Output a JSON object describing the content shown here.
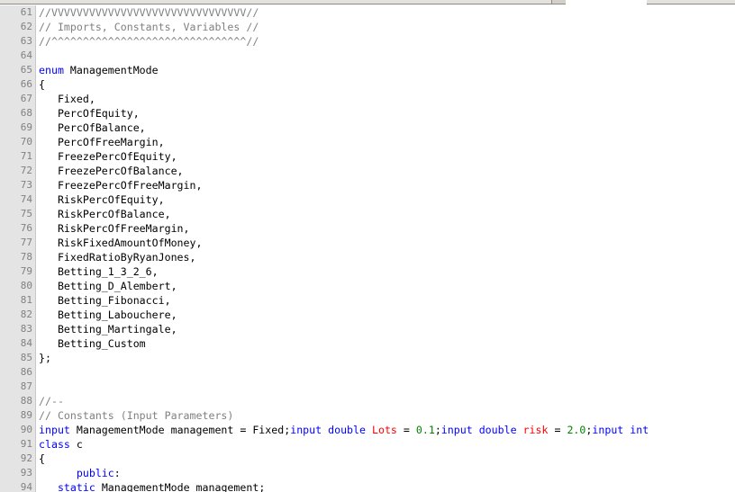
{
  "editor": {
    "lines": [
      {
        "no": "61",
        "tokens": [
          {
            "t": "//VVVVVVVVVVVVVVVVVVVVVVVVVVVVVVV//",
            "c": "comment"
          }
        ]
      },
      {
        "no": "62",
        "tokens": [
          {
            "t": "// Imports, Constants, Variables //",
            "c": "comment"
          }
        ]
      },
      {
        "no": "63",
        "tokens": [
          {
            "t": "//^^^^^^^^^^^^^^^^^^^^^^^^^^^^^^^//",
            "c": "comment"
          }
        ]
      },
      {
        "no": "64",
        "tokens": []
      },
      {
        "no": "65",
        "tokens": [
          {
            "t": "enum",
            "c": "keyword"
          },
          {
            "t": " ManagementMode",
            "c": "plain"
          }
        ]
      },
      {
        "no": "66",
        "tokens": [
          {
            "t": "{",
            "c": "plain"
          }
        ]
      },
      {
        "no": "67",
        "tokens": [
          {
            "t": "   Fixed,",
            "c": "plain"
          }
        ]
      },
      {
        "no": "68",
        "tokens": [
          {
            "t": "   PercOfEquity,",
            "c": "plain"
          }
        ]
      },
      {
        "no": "69",
        "tokens": [
          {
            "t": "   PercOfBalance,",
            "c": "plain"
          }
        ]
      },
      {
        "no": "70",
        "tokens": [
          {
            "t": "   PercOfFreeMargin,",
            "c": "plain"
          }
        ]
      },
      {
        "no": "71",
        "tokens": [
          {
            "t": "   FreezePercOfEquity,",
            "c": "plain"
          }
        ]
      },
      {
        "no": "72",
        "tokens": [
          {
            "t": "   FreezePercOfBalance,",
            "c": "plain"
          }
        ]
      },
      {
        "no": "73",
        "tokens": [
          {
            "t": "   FreezePercOfFreeMargin,",
            "c": "plain"
          }
        ]
      },
      {
        "no": "74",
        "tokens": [
          {
            "t": "   RiskPercOfEquity,",
            "c": "plain"
          }
        ]
      },
      {
        "no": "75",
        "tokens": [
          {
            "t": "   RiskPercOfBalance,",
            "c": "plain"
          }
        ]
      },
      {
        "no": "76",
        "tokens": [
          {
            "t": "   RiskPercOfFreeMargin,",
            "c": "plain"
          }
        ]
      },
      {
        "no": "77",
        "tokens": [
          {
            "t": "   RiskFixedAmountOfMoney,",
            "c": "plain"
          }
        ]
      },
      {
        "no": "78",
        "tokens": [
          {
            "t": "   FixedRatioByRyanJones,",
            "c": "plain"
          }
        ]
      },
      {
        "no": "79",
        "tokens": [
          {
            "t": "   Betting_1_3_2_6,",
            "c": "plain"
          }
        ]
      },
      {
        "no": "80",
        "tokens": [
          {
            "t": "   Betting_D_Alembert,",
            "c": "plain"
          }
        ]
      },
      {
        "no": "81",
        "tokens": [
          {
            "t": "   Betting_Fibonacci,",
            "c": "plain"
          }
        ]
      },
      {
        "no": "82",
        "tokens": [
          {
            "t": "   Betting_Labouchere,",
            "c": "plain"
          }
        ]
      },
      {
        "no": "83",
        "tokens": [
          {
            "t": "   Betting_Martingale,",
            "c": "plain"
          }
        ]
      },
      {
        "no": "84",
        "tokens": [
          {
            "t": "   Betting_Custom",
            "c": "plain"
          }
        ]
      },
      {
        "no": "85",
        "tokens": [
          {
            "t": "};",
            "c": "plain"
          }
        ]
      },
      {
        "no": "86",
        "tokens": []
      },
      {
        "no": "87",
        "tokens": []
      },
      {
        "no": "88",
        "tokens": [
          {
            "t": "//--",
            "c": "comment"
          }
        ]
      },
      {
        "no": "89",
        "tokens": [
          {
            "t": "// Constants (Input Parameters)",
            "c": "comment"
          }
        ]
      },
      {
        "no": "90",
        "tokens": [
          {
            "t": "input",
            "c": "keyword"
          },
          {
            "t": " ManagementMode management = Fixed;",
            "c": "plain"
          },
          {
            "t": "input",
            "c": "keyword"
          },
          {
            "t": " ",
            "c": "plain"
          },
          {
            "t": "double",
            "c": "type"
          },
          {
            "t": " ",
            "c": "plain"
          },
          {
            "t": "Lots",
            "c": "var"
          },
          {
            "t": " = ",
            "c": "plain"
          },
          {
            "t": "0.1",
            "c": "number"
          },
          {
            "t": ";",
            "c": "plain"
          },
          {
            "t": "input",
            "c": "keyword"
          },
          {
            "t": " ",
            "c": "plain"
          },
          {
            "t": "double",
            "c": "type"
          },
          {
            "t": " ",
            "c": "plain"
          },
          {
            "t": "risk",
            "c": "var"
          },
          {
            "t": " = ",
            "c": "plain"
          },
          {
            "t": "2.0",
            "c": "number"
          },
          {
            "t": ";",
            "c": "plain"
          },
          {
            "t": "input",
            "c": "keyword"
          },
          {
            "t": " ",
            "c": "plain"
          },
          {
            "t": "int",
            "c": "type"
          }
        ]
      },
      {
        "no": "91",
        "tokens": [
          {
            "t": "class",
            "c": "keyword"
          },
          {
            "t": " c",
            "c": "plain"
          }
        ]
      },
      {
        "no": "92",
        "tokens": [
          {
            "t": "{",
            "c": "plain"
          }
        ]
      },
      {
        "no": "93",
        "tokens": [
          {
            "t": "      ",
            "c": "plain"
          },
          {
            "t": "public",
            "c": "keyword"
          },
          {
            "t": ":",
            "c": "plain"
          }
        ]
      },
      {
        "no": "94",
        "tokens": [
          {
            "t": "   ",
            "c": "plain"
          },
          {
            "t": "static",
            "c": "keyword"
          },
          {
            "t": " ManagementMode management;",
            "c": "plain"
          }
        ]
      }
    ]
  }
}
